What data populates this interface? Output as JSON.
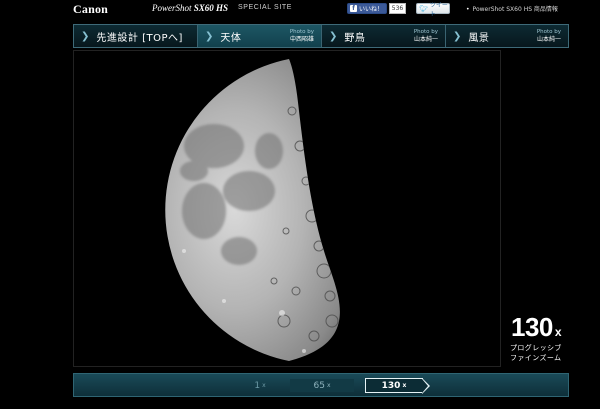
{
  "header": {
    "brand": "Canon",
    "model_prefix": "PowerShot",
    "model_name": "SX60 HS",
    "site_label": "SPECIAL SITE",
    "facebook_label": "いいね！",
    "facebook_count": "536",
    "twitter_label": "ツイート",
    "product_link": "PowerShot SX60 HS 商品情報"
  },
  "nav": {
    "tabs": [
      {
        "label": "先進設計 [TOPへ]",
        "credit_by": "",
        "credit_name": ""
      },
      {
        "label": "天体",
        "credit_by": "Photo by",
        "credit_name": "中西昭雄"
      },
      {
        "label": "野鳥",
        "credit_by": "Photo by",
        "credit_name": "山本純一"
      },
      {
        "label": "風景",
        "credit_by": "Photo by",
        "credit_name": "山本純一"
      }
    ],
    "active_tab": 1
  },
  "zoom": {
    "current_value": "130",
    "current_unit": "x",
    "description_line1": "プログレッシブ",
    "description_line2": "ファインズーム",
    "options": [
      {
        "value": "1",
        "unit": "x"
      },
      {
        "value": "65",
        "unit": "x"
      },
      {
        "value": "130",
        "unit": "x"
      }
    ],
    "selected": "130"
  },
  "colors": {
    "accent": "#1d5664",
    "nav_border": "#3e6a78",
    "facebook": "#3b5998",
    "twitter": "#2fa8d8"
  }
}
